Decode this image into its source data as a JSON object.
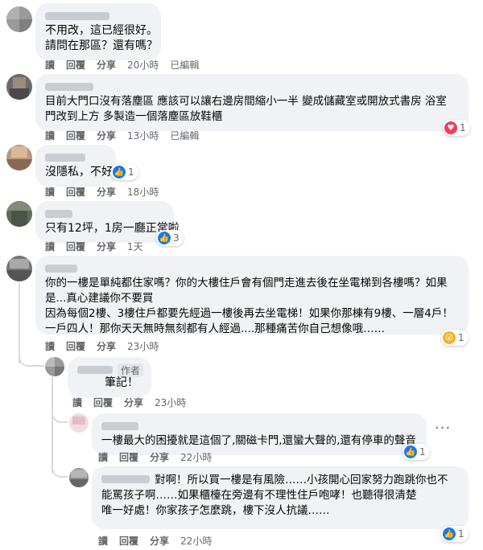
{
  "actions": {
    "read": "讀",
    "reply": "回覆",
    "share": "分享",
    "edited": "已編輯"
  },
  "comments": [
    {
      "lines": [
        "不用改，這已經很好。",
        "請問在那區？還有嗎？"
      ],
      "time": "20小時"
    },
    {
      "lines": [
        "目前大門口沒有落塵區 應該可以讓右邊房間縮小一半 變成儲藏室或開放式書房 浴室",
        "門改到上方 多製造一個落塵區放鞋櫃"
      ],
      "time": "13小時",
      "reaction": {
        "type": "heart",
        "count": "1"
      }
    },
    {
      "lines": [
        "沒隱私，不好"
      ],
      "time": "18小時",
      "reaction": {
        "type": "like",
        "count": "1"
      }
    },
    {
      "lines": [
        "只有12坪，1房一廳正常啦"
      ],
      "time": "1天",
      "reaction": {
        "type": "like",
        "count": "3"
      }
    },
    {
      "lines": [
        "你的一樓是單純都住家嗎？你的大樓住戶會有個門走進去後在坐電梯到各樓嗎？如果",
        "是...真心建議你不要買",
        "因為每個2樓、3樓住戶都要先經過一樓後再去坐電梯！如果你那棟有9樓、一層4戶！",
        "一戶四人！那你天天無時無刻都有人經過....那種痛苦你自己想像哦……"
      ],
      "time": "23小時",
      "reaction": {
        "type": "wow",
        "count": "1"
      }
    }
  ],
  "replies": [
    {
      "badge": "作者",
      "lines": [
        "筆記！"
      ],
      "time": "23小時"
    },
    {
      "lines": [
        "一樓最大的困擾就是這個了,關磁卡門,還蠻大聲的,還有停車的聲音"
      ],
      "time": "22小時",
      "reaction": {
        "type": "like",
        "count": "1"
      }
    },
    {
      "lines": [
        "對啊！所以買一樓是有風險……小孩開心回家努力跑跳你也不",
        "能罵孩子啊……如果櫃檯在旁邊有不理性住戶咆哮！也聽得很清楚",
        "唯一好處！你家孩子怎麼跳，樓下沒人抗議……"
      ],
      "time": "22小時",
      "reaction": {
        "type": "like",
        "count": "1"
      }
    }
  ],
  "icons": {
    "like": "like-icon",
    "heart": "heart-icon",
    "wow": "wow-icon",
    "more": "more-options-icon"
  },
  "colors": {
    "bubble": "#f0f2f5",
    "meta_text": "#65676b",
    "like_blue": "#1877f2",
    "heart_red": "#f33e58",
    "wow_yellow": "#f7b125"
  }
}
